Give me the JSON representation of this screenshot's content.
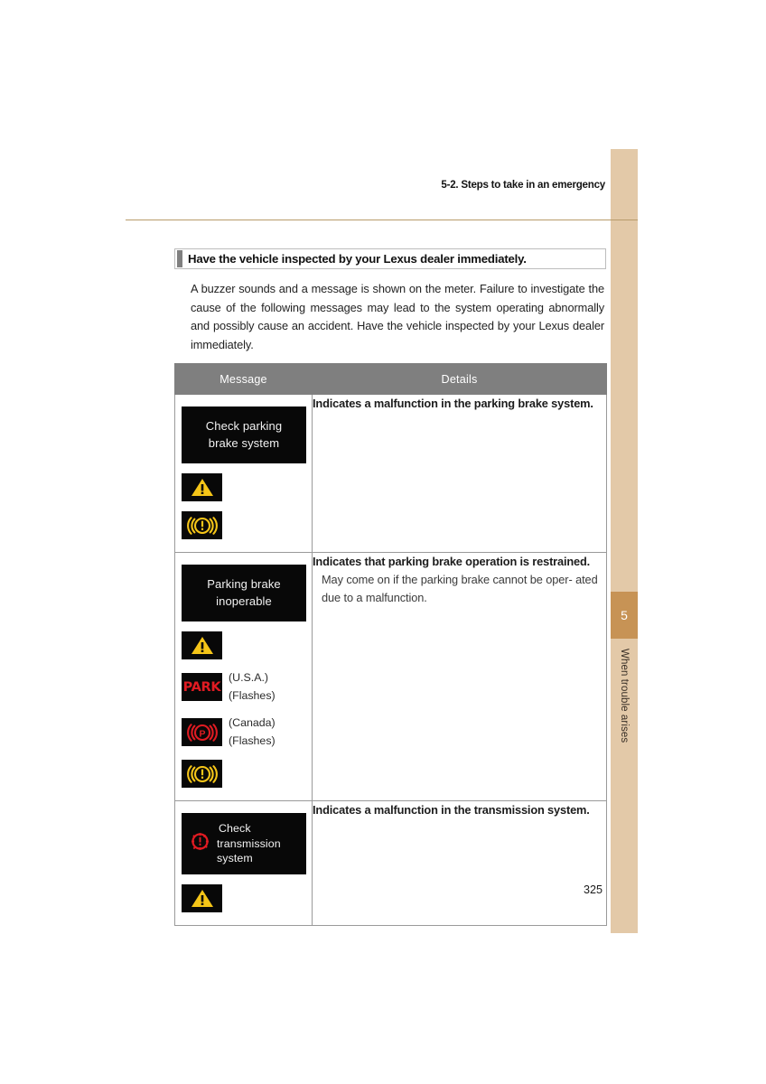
{
  "page": {
    "running_header": "5-2. Steps to take in an emergency",
    "page_number": "325"
  },
  "side_tab": {
    "chapter_number": "5",
    "chapter_label": "When trouble arises"
  },
  "section": {
    "heading": "Have the vehicle inspected by your Lexus dealer immediately.",
    "intro": "A buzzer sounds and a message is shown on the meter. Failure to investigate the cause of the following messages may lead to the system operating abnormally and possibly cause an accident. Have the vehicle inspected by your Lexus dealer immediately."
  },
  "table": {
    "headers": {
      "message": "Message",
      "details": "Details"
    },
    "rows": [
      {
        "display_lines": [
          "Check parking",
          "brake system"
        ],
        "icons": [
          {
            "name": "warning-triangle-icon",
            "caption": []
          },
          {
            "name": "brake-warning-icon",
            "caption": []
          }
        ],
        "details_lead": "Indicates a malfunction in the parking brake system.",
        "details_sub": []
      },
      {
        "display_lines": [
          "Parking brake",
          "inoperable"
        ],
        "icons": [
          {
            "name": "warning-triangle-icon",
            "caption": []
          },
          {
            "name": "park-indicator-icon",
            "label": "PARK",
            "caption": [
              "(U.S.A.)",
              "(Flashes)"
            ]
          },
          {
            "name": "parking-brake-canada-icon",
            "caption": [
              "(Canada)",
              "(Flashes)"
            ]
          },
          {
            "name": "brake-warning-icon",
            "caption": []
          }
        ],
        "details_lead": "Indicates that parking brake operation is restrained.",
        "details_sub": [
          "May come on if the parking brake cannot be oper-",
          "ated due to a malfunction."
        ]
      },
      {
        "display_lines": [
          "Check",
          "transmission system"
        ],
        "display_icon": "transmission-gear-warning-icon",
        "icons": [
          {
            "name": "warning-triangle-icon",
            "caption": []
          }
        ],
        "details_lead": "Indicates a malfunction in the transmission system.",
        "details_sub": []
      }
    ]
  },
  "colors": {
    "tab_light": "#e3c9a8",
    "tab_dark": "#c79355",
    "header_rule": "#b89b6a",
    "table_header_bg": "#7f7f7f",
    "warning_yellow": "#f5c518",
    "warning_red": "#e01b22"
  }
}
